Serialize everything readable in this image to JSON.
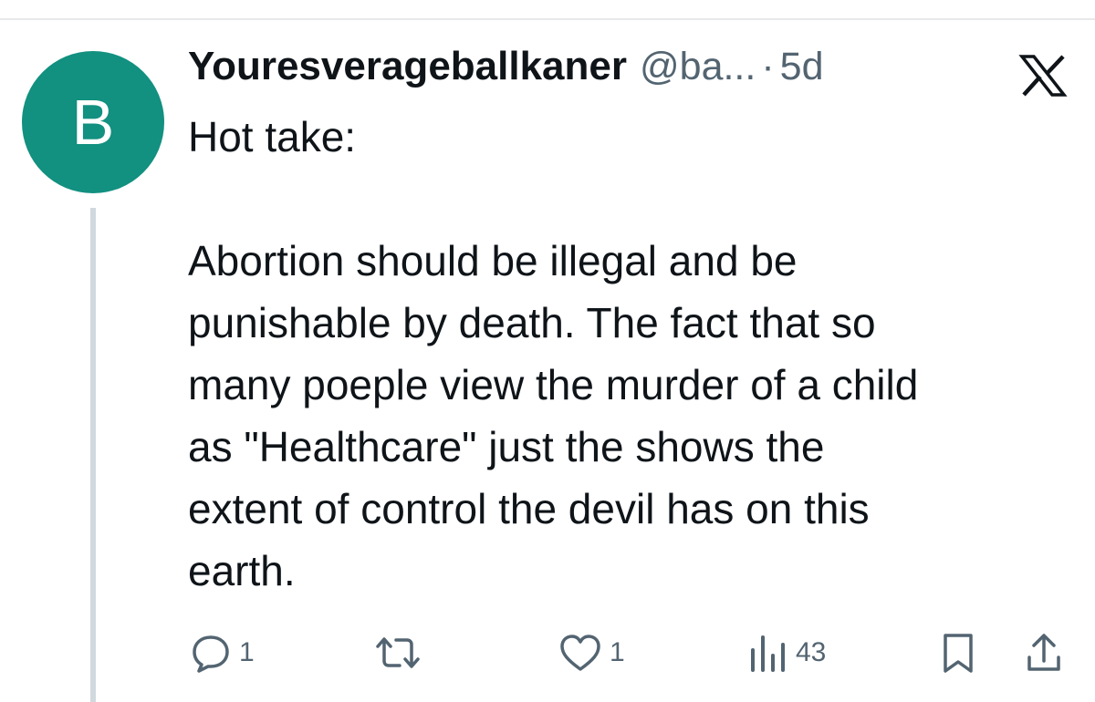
{
  "tweet": {
    "author": {
      "avatar_letter": "B",
      "avatar_color": "#129080",
      "display_name": "Youresverageballkaner",
      "handle": "@ba...",
      "separator": "·",
      "time": "5d"
    },
    "text": "Hot take:\n\nAbortion should be illegal and be\npunishable by death. The fact that so\nmany poeple view the murder of a child\nas \"Healthcare\" just the shows the\nextent of control the devil has on this\nearth.",
    "platform_icon": "x-logo-icon",
    "actions": {
      "replies": "1",
      "reposts": "",
      "likes": "1",
      "views": "43"
    }
  },
  "colors": {
    "text_primary": "#0f1419",
    "text_secondary": "#536471",
    "thread_line": "#cfd9de",
    "divider": "#e7e9ea"
  }
}
